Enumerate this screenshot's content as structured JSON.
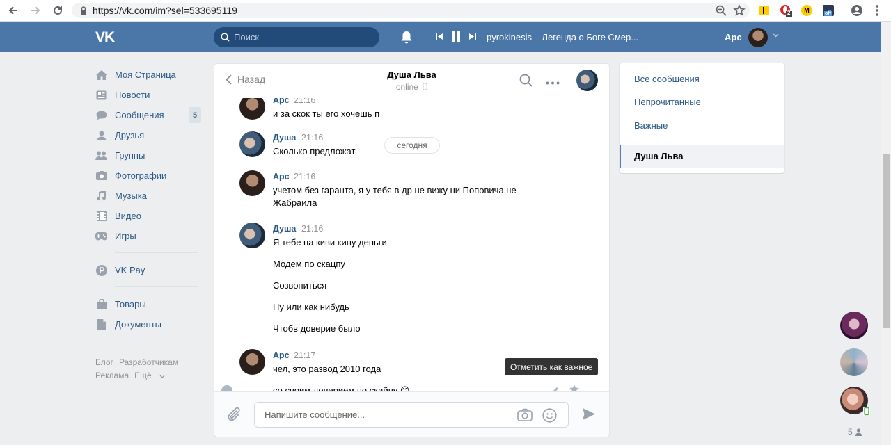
{
  "browser": {
    "url": "https://vk.com/im?sel=533695119",
    "ext_badges": [
      "2",
      "M",
      "off"
    ]
  },
  "header": {
    "logo": "VK",
    "search_placeholder": "Поиск",
    "track": "pyrokinesis – Легенда о Боге Смер...",
    "user_name": "Арс"
  },
  "sidebar": {
    "items": [
      {
        "label": "Моя Страница",
        "icon": "home-icon"
      },
      {
        "label": "Новости",
        "icon": "news-icon"
      },
      {
        "label": "Сообщения",
        "icon": "messages-icon",
        "badge": "5"
      },
      {
        "label": "Друзья",
        "icon": "friends-icon"
      },
      {
        "label": "Группы",
        "icon": "groups-icon"
      },
      {
        "label": "Фотографии",
        "icon": "photos-icon"
      },
      {
        "label": "Музыка",
        "icon": "music-icon"
      },
      {
        "label": "Видео",
        "icon": "video-icon"
      },
      {
        "label": "Игры",
        "icon": "games-icon"
      }
    ],
    "extra": [
      {
        "label": "VK Pay",
        "icon": "vkpay-icon"
      }
    ],
    "extra2": [
      {
        "label": "Товары",
        "icon": "goods-icon"
      },
      {
        "label": "Документы",
        "icon": "documents-icon"
      }
    ],
    "footer": [
      "Блог",
      "Разработчикам",
      "Реклама",
      "Ещё"
    ]
  },
  "chat": {
    "back_label": "Назад",
    "title": "Душа Льва",
    "status": "online",
    "date_pill": "сегодня",
    "tooltip": "Отметить как важное",
    "messages": [
      {
        "author": "Арс",
        "time": "21:16",
        "lines": [
          "и за скок ты его хочешь п"
        ]
      },
      {
        "author": "Душа",
        "time": "21:16",
        "lines": [
          "Сколько предложат"
        ]
      },
      {
        "author": "Арс",
        "time": "21:16",
        "lines": [
          "учетом без гаранта, я у тебя в др не вижу ни Поповича,не Жабраила"
        ]
      },
      {
        "author": "Душа",
        "time": "21:16",
        "lines": [
          "Я тебе на киви кину деньги",
          "Модем по скацпу",
          "Созвониться",
          "Ну или как нибудь",
          "Чтобв доверие было"
        ]
      },
      {
        "author": "Арс",
        "time": "21:17",
        "lines": [
          "чел, это развод 2010 года",
          "со своим доверием по скайпу 😊"
        ]
      }
    ],
    "input_placeholder": "Напишите сообщение..."
  },
  "right_menu": {
    "items": [
      "Все сообщения",
      "Непрочитанные",
      "Важные"
    ],
    "active": "Душа Льва"
  },
  "fast_chat": {
    "count": "5"
  }
}
